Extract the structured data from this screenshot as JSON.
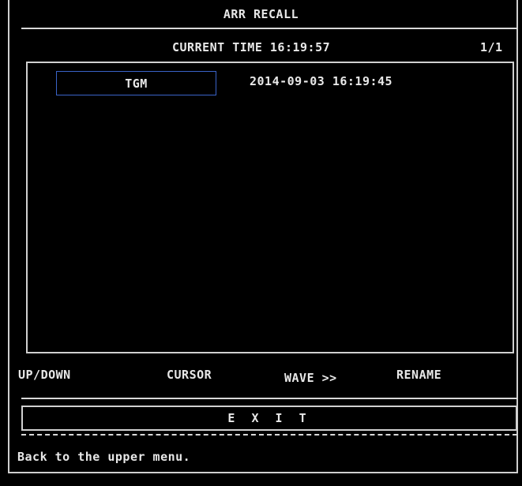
{
  "header": {
    "title": "ARR RECALL"
  },
  "status": {
    "current_time": "CURRENT TIME 16:19:57",
    "page": "1/1"
  },
  "list": {
    "items": [
      {
        "name": "TGM",
        "timestamp": "2014-09-03 16:19:45"
      }
    ]
  },
  "functions": {
    "up_down": "UP/DOWN",
    "cursor": "CURSOR",
    "wave": "WAVE >>",
    "rename": "RENAME"
  },
  "exit": {
    "label": "E X I T"
  },
  "help": {
    "text": "Back to the upper menu."
  }
}
